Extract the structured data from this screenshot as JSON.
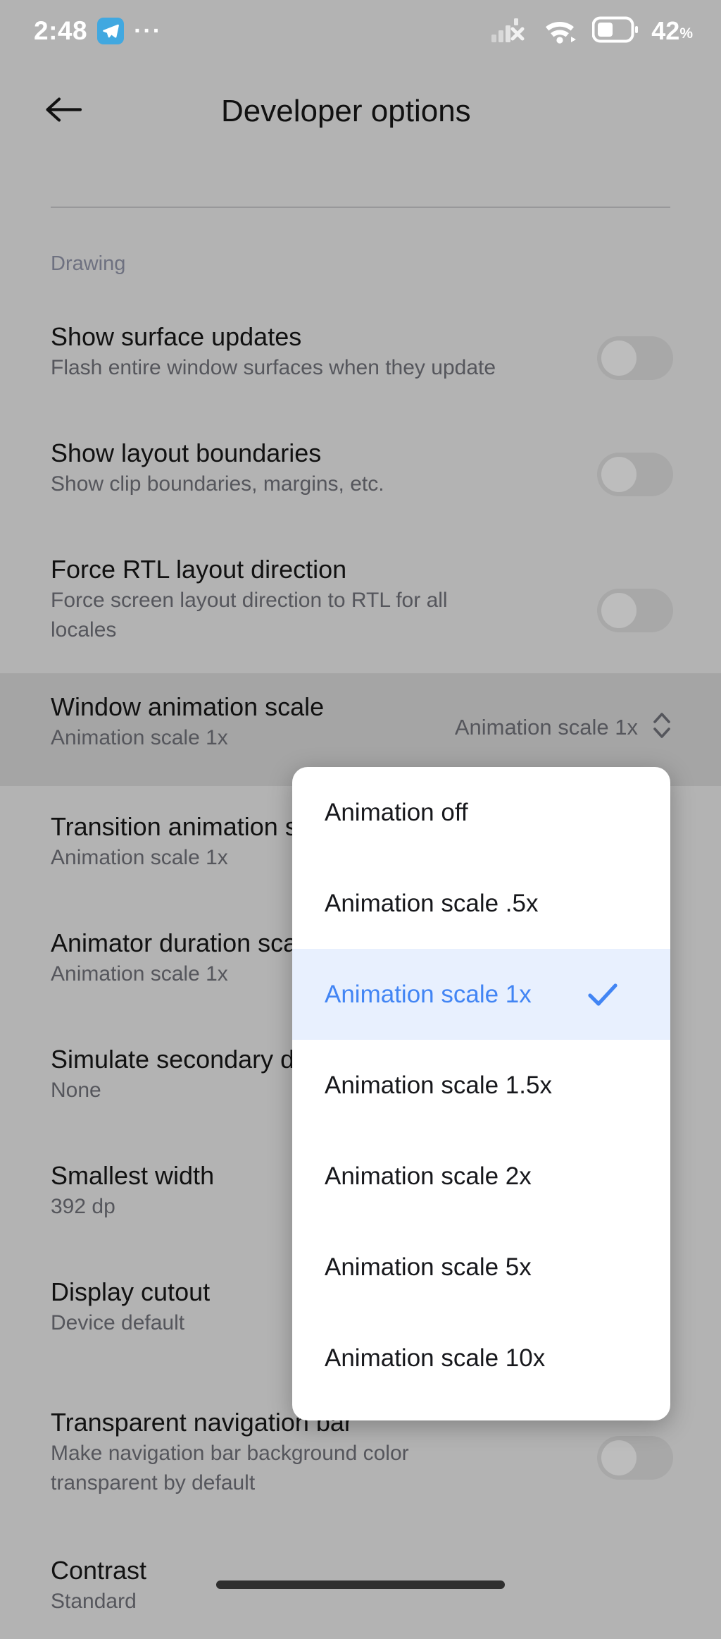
{
  "status_bar": {
    "time": "2:48",
    "telegram_icon": "telegram-icon",
    "overflow_dots": "···",
    "signal_icon": "cellular-signal-off-icon",
    "wifi_icon": "wifi-icon",
    "battery_icon": "battery-icon",
    "battery_level": "42",
    "battery_unit": "%"
  },
  "app_bar": {
    "back_icon": "back-arrow-icon",
    "title": "Developer options"
  },
  "section": {
    "label": "Drawing"
  },
  "settings": [
    {
      "title": "Show surface updates",
      "subtitle": "Flash entire window surfaces when they update",
      "control": "toggle",
      "value": "off"
    },
    {
      "title": "Show layout boundaries",
      "subtitle": "Show clip boundaries, margins, etc.",
      "control": "toggle",
      "value": "off"
    },
    {
      "title": "Force RTL layout direction",
      "subtitle": "Force screen layout direction to RTL for all locales",
      "control": "toggle",
      "value": "off"
    },
    {
      "title": "Window animation scale",
      "subtitle": "Animation scale 1x",
      "control": "stepper",
      "value": "Animation scale 1x",
      "pressed": true
    },
    {
      "title": "Transition animation scale",
      "subtitle": "Animation scale 1x",
      "control": "none",
      "value": ""
    },
    {
      "title": "Animator duration scale",
      "subtitle": "Animation scale 1x",
      "control": "none",
      "value": ""
    },
    {
      "title": "Simulate secondary displays",
      "subtitle": "None",
      "control": "none",
      "value": ""
    },
    {
      "title": "Smallest width",
      "subtitle": "392 dp",
      "control": "none",
      "value": ""
    },
    {
      "title": "Display cutout",
      "subtitle": "Device default",
      "control": "none",
      "value": ""
    },
    {
      "title": "Transparent navigation bar",
      "subtitle": "Make navigation bar background color transparent by default",
      "control": "toggle",
      "value": "off"
    },
    {
      "title": "Contrast",
      "subtitle": "Standard",
      "control": "none",
      "value": ""
    }
  ],
  "dropdown": {
    "title": "Window animation scale",
    "selected": "Animation scale 1x",
    "check_icon": "check-icon",
    "options": [
      {
        "label": "Animation off",
        "selected": false
      },
      {
        "label": "Animation scale .5x",
        "selected": false
      },
      {
        "label": "Animation scale 1x",
        "selected": true
      },
      {
        "label": "Animation scale 1.5x",
        "selected": false
      },
      {
        "label": "Animation scale 2x",
        "selected": false
      },
      {
        "label": "Animation scale 5x",
        "selected": false
      },
      {
        "label": "Animation scale 10x",
        "selected": false
      }
    ]
  },
  "colors": {
    "page_background": "#b3b3b3",
    "accent_blue": "#4285f4",
    "selected_row_background": "#e8f0fe",
    "section_label": "#6e7180",
    "primary_text": "#111111",
    "secondary_text": "#55565c",
    "surface_white": "#ffffff"
  },
  "home_indicator": "home-indicator"
}
